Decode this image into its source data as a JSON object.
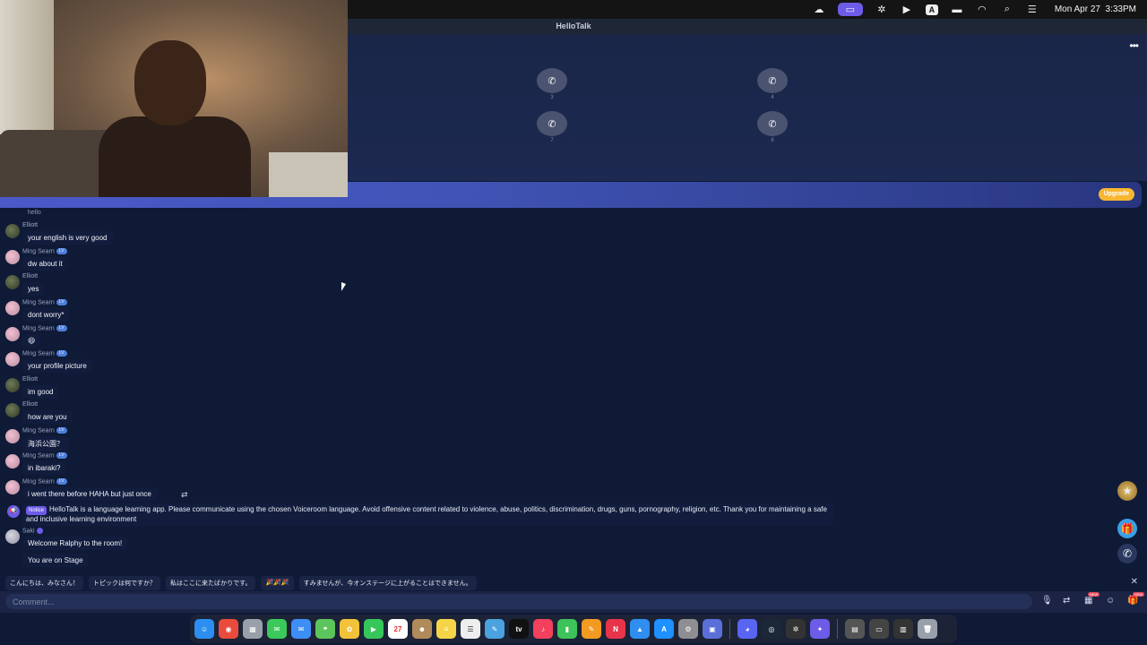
{
  "menubar": {
    "date": "Mon Apr 27",
    "time": "3:33PM",
    "input_source": "A"
  },
  "window": {
    "title": "HelloTalk"
  },
  "stage": {
    "more": "•••",
    "seats": [
      {
        "num": "3"
      },
      {
        "num": "4"
      },
      {
        "num": "7"
      },
      {
        "num": "8"
      }
    ]
  },
  "banner": {
    "upgrade_label": "Upgrade"
  },
  "chat": {
    "partial_text": "hello",
    "messages": [
      {
        "user": "Elliott",
        "avatar": "elliott",
        "text": "your english is very good",
        "badge": ""
      },
      {
        "user": "Ming Searn",
        "avatar": "ming",
        "text": "dw about it",
        "badge": "LV"
      },
      {
        "user": "Elliott",
        "avatar": "elliott",
        "text": "yes",
        "badge": ""
      },
      {
        "user": "Ming Searn",
        "avatar": "ming",
        "text": "dont worry*",
        "badge": "LV"
      },
      {
        "user": "Ming Searn",
        "avatar": "ming",
        "text": "😄",
        "badge": "LV"
      },
      {
        "user": "Ming Searn",
        "avatar": "ming",
        "text": "your profile picture",
        "badge": "LV"
      },
      {
        "user": "Elliott",
        "avatar": "elliott",
        "text": "im good",
        "badge": ""
      },
      {
        "user": "Elliott",
        "avatar": "elliott",
        "text": "how are you",
        "badge": ""
      },
      {
        "user": "Ming Searn",
        "avatar": "ming",
        "text": "海浜公園？",
        "badge": "LV"
      },
      {
        "user": "Ming Searn",
        "avatar": "ming",
        "text": "in ibaraki?",
        "badge": "LV"
      },
      {
        "user": "Ming Searn",
        "avatar": "ming",
        "text": "i went there before HAHA but just once",
        "badge": "LV"
      }
    ],
    "notice_tag": "Notice",
    "notice_text": "HelloTalk is a language learning app. Please communicate using the chosen Voiceroom language. Avoid offensive content related to violence, abuse, politics, discrimination, drugs, guns, pornography, religion, etc. Thank you for maintaining a safe and inclusive learning environment",
    "saki_user": "Saki",
    "welcome_text": "Welcome Ralphy to the room!",
    "stage_note": "You are on Stage"
  },
  "quick_replies": [
    "こんにちは、みなさん！",
    "トピックは何ですか？",
    "私はここに来たばかりです。",
    "🎉🎉🎉",
    "すみませんが、今オンステージに上がることはできません。"
  ],
  "comment": {
    "placeholder": "Comment..."
  },
  "new_label": "NEW"
}
